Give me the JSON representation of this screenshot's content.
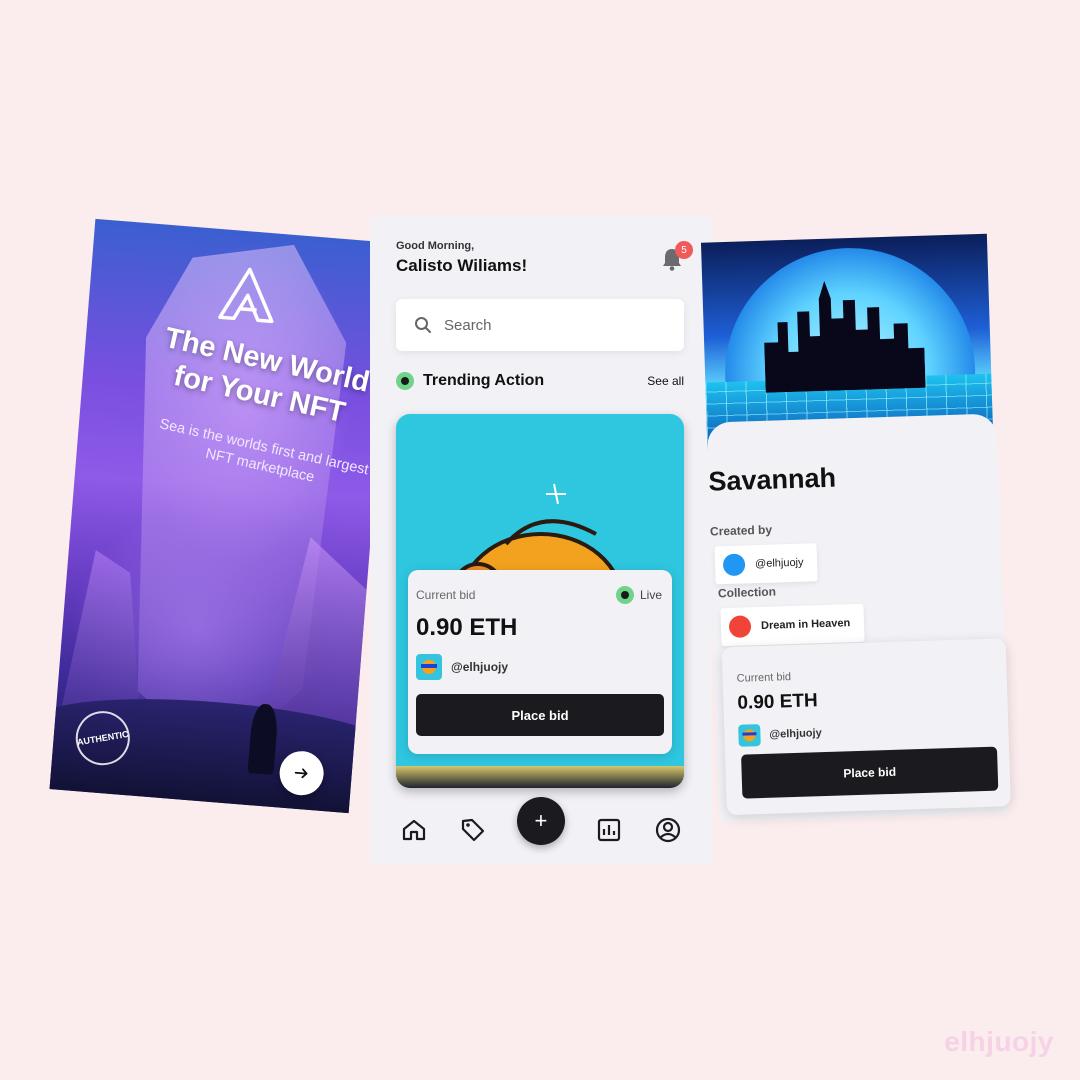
{
  "onboarding": {
    "headline": "The New World for Your NFT",
    "subtitle": "Sea is the worlds first and largest NFT marketplace",
    "badge_text": "AUTHENTIC",
    "next_icon": "arrow-right-icon"
  },
  "home": {
    "greeting": "Good Morning,",
    "user_name": "Calisto Wiliams!",
    "notification_count": "5",
    "search": {
      "placeholder": "Search"
    },
    "section_title": "Trending Action",
    "see_all": "See all",
    "card": {
      "bid_label": "Current bid",
      "status": "Live",
      "amount": "0.90 ETH",
      "creator": "@elhjuojy",
      "button": "Place bid"
    },
    "nav": [
      "home-icon",
      "tag-icon",
      "plus-icon",
      "chart-icon",
      "profile-icon"
    ],
    "fab_symbol": "+"
  },
  "detail": {
    "title": "Savannah",
    "created_by_label": "Created by",
    "creator": "@elhjuojy",
    "creator_color": "#2196f3",
    "collection_label": "Collection",
    "collection": "Dream in Heaven",
    "collection_color": "#f04438",
    "bid_label": "Current bid",
    "amount": "0.90 ETH",
    "owner": "@elhjuojy",
    "button": "Place bid"
  },
  "watermark": "elhjuojy",
  "colors": {
    "background": "#fbeced",
    "accent_dark": "#1b1b1f",
    "live_green": "#6fd48a",
    "badge_red": "#f05a5a"
  }
}
